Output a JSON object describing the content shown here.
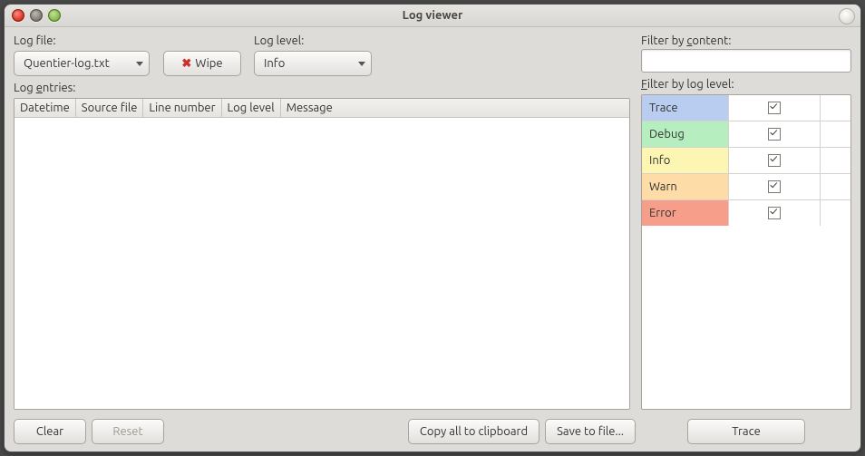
{
  "window": {
    "title": "Log viewer"
  },
  "controls": {
    "log_file_label": "Log file:",
    "log_file_value": "Quentier-log.txt",
    "wipe_label": "Wipe",
    "log_level_label": "Log level:",
    "log_level_value": "Info",
    "log_entries_label_pre": "Log ",
    "log_entries_label_u": "e",
    "log_entries_label_post": "ntries:"
  },
  "columns": {
    "c0": "Datetime",
    "c1": "Source file",
    "c2": "Line number",
    "c3": "Log level",
    "c4": "Message"
  },
  "filter": {
    "content_label_pre": "Filter by ",
    "content_label_u": "c",
    "content_label_post": "ontent:",
    "content_value": "",
    "level_label_pre": "",
    "level_label_u": "F",
    "level_label_post": "ilter by log level:"
  },
  "levels": [
    {
      "name": "Trace",
      "color": "#b9cdf0",
      "checked": true
    },
    {
      "name": "Debug",
      "color": "#b6eec0",
      "checked": true
    },
    {
      "name": "Info",
      "color": "#fdf6b2",
      "checked": true
    },
    {
      "name": "Warn",
      "color": "#fddca8",
      "checked": true
    },
    {
      "name": "Error",
      "color": "#f79e8b",
      "checked": true
    }
  ],
  "footer": {
    "clear": "Clear",
    "reset": "Reset",
    "copy": "Copy all to clipboard",
    "save": "Save to file...",
    "trace": "Trace"
  }
}
